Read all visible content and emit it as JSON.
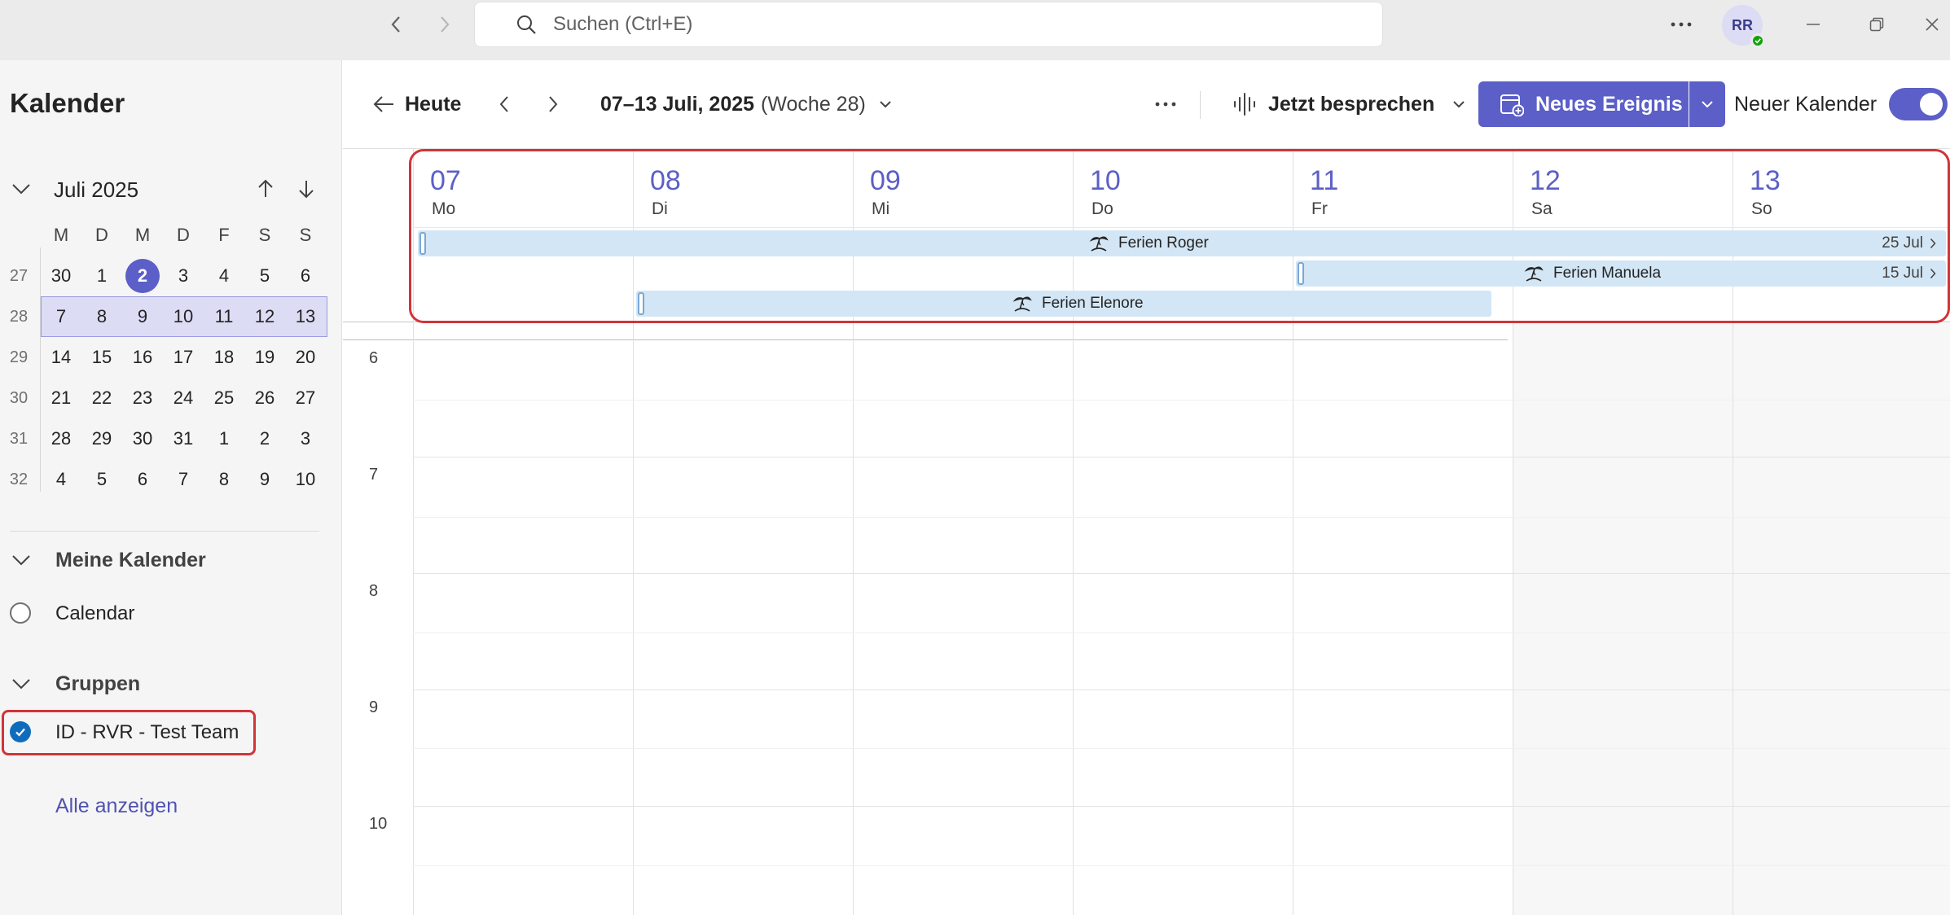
{
  "titlebar": {
    "back_icon": "chevron-left-icon",
    "forward_icon": "chevron-right-icon",
    "search_placeholder": "Suchen (Ctrl+E)",
    "more_icon": "more-horizontal-icon",
    "avatar_initials": "RR",
    "presence_status": "available",
    "colors": {
      "bar": "#ebebeb",
      "presence": "#13a10e"
    }
  },
  "sidebar": {
    "title": "Kalender",
    "mini_calendar": {
      "month_label": "Juli 2025",
      "weekday_headers": [
        "M",
        "D",
        "M",
        "D",
        "F",
        "S",
        "S"
      ],
      "weeks": [
        {
          "week": "27",
          "days": [
            "30",
            "1",
            "2",
            "3",
            "4",
            "5",
            "6"
          ]
        },
        {
          "week": "28",
          "days": [
            "7",
            "8",
            "9",
            "10",
            "11",
            "12",
            "13"
          ]
        },
        {
          "week": "29",
          "days": [
            "14",
            "15",
            "16",
            "17",
            "18",
            "19",
            "20"
          ]
        },
        {
          "week": "30",
          "days": [
            "21",
            "22",
            "23",
            "24",
            "25",
            "26",
            "27"
          ]
        },
        {
          "week": "31",
          "days": [
            "28",
            "29",
            "30",
            "31",
            "1",
            "2",
            "3"
          ]
        },
        {
          "week": "32",
          "days": [
            "4",
            "5",
            "6",
            "7",
            "8",
            "9",
            "10"
          ]
        }
      ],
      "today": "2",
      "selected_week": "28"
    },
    "my_calendars": {
      "label": "Meine Kalender",
      "items": [
        {
          "label": "Calendar",
          "checked": false
        }
      ]
    },
    "groups": {
      "label": "Gruppen",
      "items": [
        {
          "label": "ID - RVR - Test Team",
          "checked": true
        }
      ]
    },
    "show_all": "Alle anzeigen"
  },
  "toolbar": {
    "today_label": "Heute",
    "range_main": "07–13 Juli, 2025",
    "range_week": "(Woche 28)",
    "meet_now_label": "Jetzt besprechen",
    "new_event_label": "Neues Ereignis",
    "new_calendar_label": "Neuer Kalender",
    "new_calendar_enabled": true,
    "colors": {
      "accent": "#5b5fc7"
    }
  },
  "week": {
    "days": [
      {
        "num": "07",
        "name": "Mo",
        "weekend": false
      },
      {
        "num": "08",
        "name": "Di",
        "weekend": false
      },
      {
        "num": "09",
        "name": "Mi",
        "weekend": false
      },
      {
        "num": "10",
        "name": "Do",
        "weekend": false
      },
      {
        "num": "11",
        "name": "Fr",
        "weekend": false
      },
      {
        "num": "12",
        "name": "Sa",
        "weekend": true
      },
      {
        "num": "13",
        "name": "So",
        "weekend": true
      }
    ],
    "all_day_events": [
      {
        "title": "Ferien Roger",
        "start_day": "07",
        "ends": "25 Jul",
        "icon": "vacation-icon"
      },
      {
        "title": "Ferien Manuela",
        "start_day": "11",
        "ends": "15 Jul",
        "icon": "vacation-icon"
      },
      {
        "title": "Ferien Elenore",
        "start_day": "08",
        "end_day": "11",
        "icon": "vacation-icon"
      }
    ],
    "hours": [
      "6",
      "7",
      "8",
      "9",
      "10"
    ],
    "colors": {
      "event_bg": "#d3e6f5",
      "weekend_bg": "#f7f7f7",
      "day_number": "#5b5fc7"
    }
  }
}
